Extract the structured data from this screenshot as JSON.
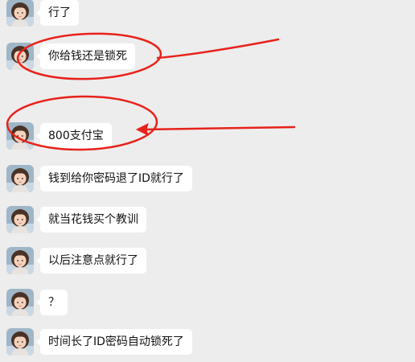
{
  "colors": {
    "background": "#ededed",
    "bubble": "#ffffff",
    "text": "#111111",
    "annotation": "#e8221b"
  },
  "messages": [
    {
      "text": "行了",
      "avatar": "avatar-girl"
    },
    {
      "text": "你给钱还是锁死",
      "avatar": "avatar-girl"
    },
    {
      "text": "800支付宝",
      "avatar": "avatar-girl"
    },
    {
      "text": "钱到给你密码退了ID就行了",
      "avatar": "avatar-girl"
    },
    {
      "text": "就当花钱买个教训",
      "avatar": "avatar-girl"
    },
    {
      "text": "以后注意点就行了",
      "avatar": "avatar-girl"
    },
    {
      "text": "？",
      "avatar": "avatar-girl"
    },
    {
      "text": "时间长了ID密码自动锁死了",
      "avatar": "avatar-girl"
    }
  ]
}
